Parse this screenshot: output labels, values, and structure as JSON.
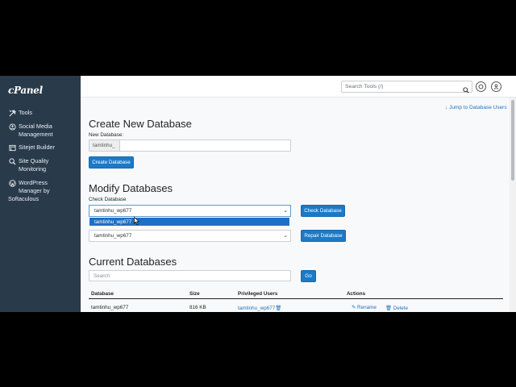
{
  "sidebar": {
    "logo": "cPanel",
    "items": [
      {
        "label": "Tools",
        "icon": "tools-icon"
      },
      {
        "label": "Social Media Management",
        "line1": "Social Media",
        "line2": "Management",
        "icon": "social-media-icon"
      },
      {
        "label": "Sitejet Builder",
        "icon": "sitejet-icon"
      },
      {
        "label": "Site Quality Monitoring",
        "line1": "Site Quality",
        "line2": "Monitoring",
        "icon": "site-quality-icon"
      },
      {
        "label": "WordPress Manager by Softaculous",
        "line1": "WordPress",
        "line2": "Manager by",
        "line3": "Softaculous",
        "icon": "wordpress-icon"
      }
    ]
  },
  "header": {
    "search_placeholder": "Search Tools (/)",
    "colors": {
      "sidebar": "#293a4a",
      "accent": "#1b7ac8"
    }
  },
  "main": {
    "jump_link": "Jump to Database Users",
    "create": {
      "title": "Create New Database",
      "field_label": "New Database:",
      "prefix": "tamtinhu_",
      "value": "",
      "button": "Create Database"
    },
    "modify": {
      "title": "Modify Databases",
      "check_label": "Check Database",
      "check_select_value": "tamtinhu_wp677",
      "dropdown_option": "tamtinhu_wp677",
      "check_button": "Check Database",
      "repair_select_value": "tamtinhu_wp677",
      "repair_button": "Repair Database"
    },
    "current": {
      "title": "Current Databases",
      "search_placeholder": "Search",
      "go_button": "Go",
      "columns": [
        "Database",
        "Size",
        "Privileged Users",
        "Actions"
      ],
      "rows": [
        {
          "database": "tamtinhu_wp677",
          "size": "816 KB",
          "user": "tamtinhu_wp677",
          "rename": "Rename",
          "delete": "Delete"
        }
      ]
    }
  }
}
